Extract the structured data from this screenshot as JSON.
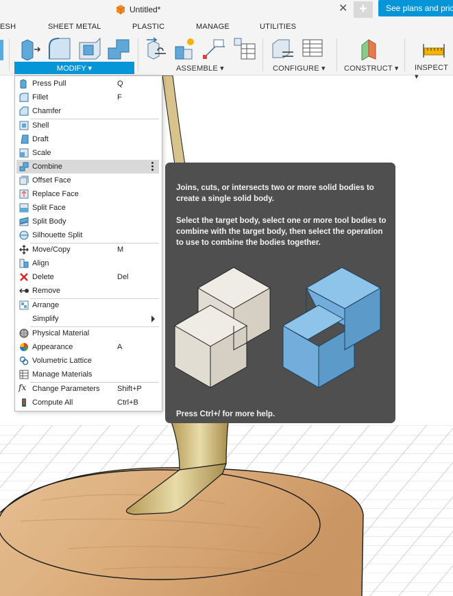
{
  "titlebar": {
    "doc_title": "Untitled*",
    "close_icon": "close-icon",
    "new_tab_label": "+",
    "plans_button": "See plans and pricing"
  },
  "workspace_tabs": [
    "ESH",
    "SHEET METAL",
    "PLASTIC",
    "MANAGE",
    "UTILITIES"
  ],
  "toolbar": {
    "modify_label": "MODIFY ▾",
    "assemble_label": "ASSEMBLE ▾",
    "configure_label": "CONFIGURE ▾",
    "construct_label": "CONSTRUCT ▾",
    "inspect_label": "INSPECT ▾"
  },
  "menu": {
    "items": [
      {
        "label": "Press Pull",
        "shortcut": "Q",
        "icon": "press-pull-icon"
      },
      {
        "label": "Fillet",
        "shortcut": "F",
        "icon": "fillet-icon"
      },
      {
        "label": "Chamfer",
        "shortcut": "",
        "icon": "chamfer-icon"
      },
      {
        "label": "Shell",
        "shortcut": "",
        "icon": "shell-icon"
      },
      {
        "label": "Draft",
        "shortcut": "",
        "icon": "draft-icon"
      },
      {
        "label": "Scale",
        "shortcut": "",
        "icon": "scale-icon"
      },
      {
        "label": "Combine",
        "shortcut": "",
        "icon": "combine-icon"
      },
      {
        "label": "Offset Face",
        "shortcut": "",
        "icon": "offset-face-icon"
      },
      {
        "label": "Replace Face",
        "shortcut": "",
        "icon": "replace-face-icon"
      },
      {
        "label": "Split Face",
        "shortcut": "",
        "icon": "split-face-icon"
      },
      {
        "label": "Split Body",
        "shortcut": "",
        "icon": "split-body-icon"
      },
      {
        "label": "Silhouette Split",
        "shortcut": "",
        "icon": "silhouette-split-icon"
      },
      {
        "label": "Move/Copy",
        "shortcut": "M",
        "icon": "move-icon"
      },
      {
        "label": "Align",
        "shortcut": "",
        "icon": "align-icon"
      },
      {
        "label": "Delete",
        "shortcut": "Del",
        "icon": "delete-icon"
      },
      {
        "label": "Remove",
        "shortcut": "",
        "icon": "remove-icon"
      },
      {
        "label": "Arrange",
        "shortcut": "",
        "icon": "arrange-icon"
      },
      {
        "label": "Simplify",
        "shortcut": "",
        "icon": "simplify-icon"
      },
      {
        "label": "Physical Material",
        "shortcut": "",
        "icon": "physical-material-icon"
      },
      {
        "label": "Appearance",
        "shortcut": "A",
        "icon": "appearance-icon"
      },
      {
        "label": "Volumetric Lattice",
        "shortcut": "",
        "icon": "volumetric-lattice-icon"
      },
      {
        "label": "Manage Materials",
        "shortcut": "",
        "icon": "manage-materials-icon"
      },
      {
        "label": "Change Parameters",
        "shortcut": "Shift+P",
        "icon": "change-parameters-icon"
      },
      {
        "label": "Compute All",
        "shortcut": "Ctrl+B",
        "icon": "compute-all-icon"
      }
    ]
  },
  "tooltip": {
    "paragraph1": "Joins, cuts, or intersects two or more solid bodies to create a single solid body.",
    "paragraph2": "Select the target body, select one or more tool bodies to combine with the target body, then select the operation to use to combine the bodies together.",
    "help": "Press Ctrl+/ for more help."
  },
  "colors": {
    "accent": "#0696d7",
    "tooltip_bg": "#4f4f4f",
    "menu_hover": "#d9d9d9"
  }
}
